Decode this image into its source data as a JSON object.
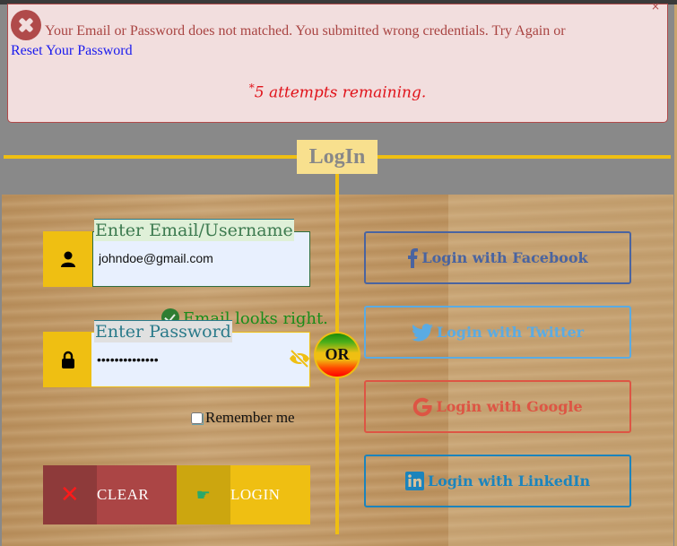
{
  "alert": {
    "message": "Your Email or Password does not matched. You submitted wrong credentials. Try Again or",
    "reset_link": "Reset Your Password",
    "attempts_marker": "*",
    "attempts_text": "5 attempts remaining.",
    "close_glyph": "×",
    "icon": "error-circle-x-icon"
  },
  "header": {
    "title": "LogIn"
  },
  "form": {
    "email": {
      "label": "Enter Email/Username",
      "value": "johndoe@gmail.com",
      "icon": "user-icon",
      "validation": "Email looks right."
    },
    "password": {
      "label": "Enter Password",
      "value": "**************",
      "icon": "lock-icon",
      "toggle_icon": "eye-slash-icon"
    },
    "remember_label": "Remember me",
    "remember_checked": false,
    "clear_label": "CLEAR",
    "clear_icon": "✕",
    "login_label": "LOGIN",
    "login_icon": "☛"
  },
  "divider": {
    "or_label": "OR"
  },
  "social": [
    {
      "label": "Login with Facebook",
      "icon": "facebook-icon",
      "color": "#4a64a0"
    },
    {
      "label": "Login with Twitter",
      "icon": "twitter-icon",
      "color": "#5aabe3"
    },
    {
      "label": "Login with Google",
      "icon": "google-icon",
      "color": "#dd5544"
    },
    {
      "label": "Login with LinkedIn",
      "icon": "linkedin-icon",
      "color": "#1c84bc"
    }
  ],
  "colors": {
    "accent": "#efbf12",
    "alert_bg": "#f2dede",
    "alert_text": "#a94442",
    "clear_button": "#ab4545",
    "valid_green": "#1a8c1a"
  }
}
